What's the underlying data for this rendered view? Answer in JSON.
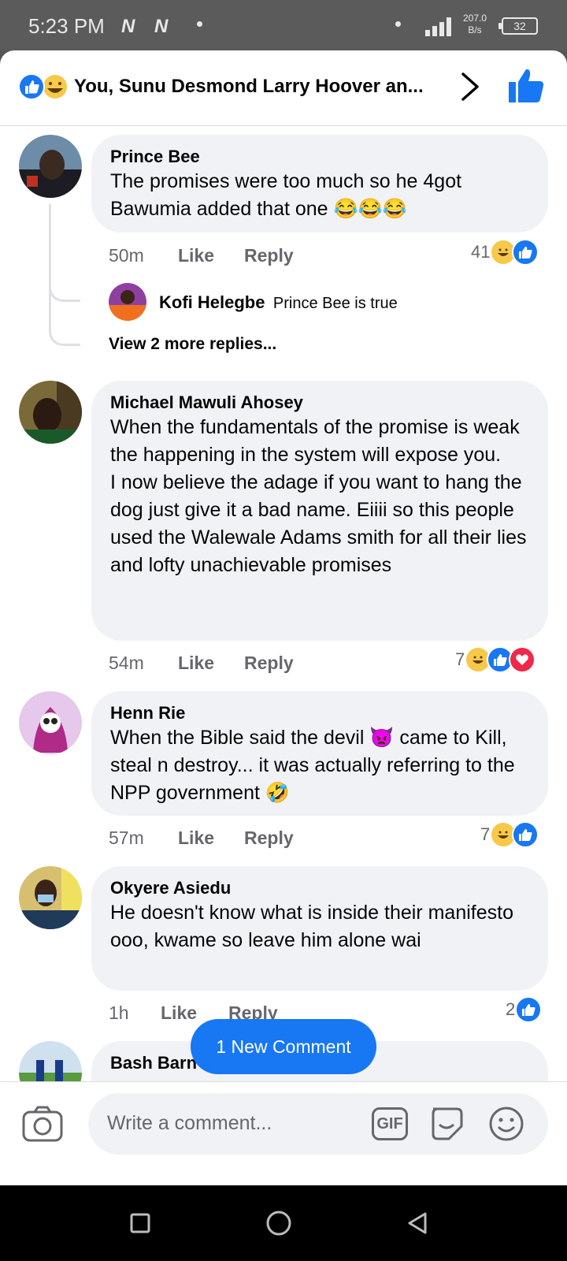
{
  "status_bar": {
    "time": "5:23 PM",
    "net_speed_value": "207.0",
    "net_speed_unit": "B/s",
    "battery": "32"
  },
  "header": {
    "title": "You, Sunu Desmond Larry Hoover an..."
  },
  "comments": [
    {
      "name": "Prince Bee",
      "text": "The promises were too much so he 4got Bawumia added that one 😂😂😂",
      "time": "50m",
      "like_label": "Like",
      "reply_label": "Reply",
      "reaction_count": "41",
      "reactions": [
        "haha",
        "like"
      ],
      "reply": {
        "name": "Kofi Helegbe",
        "text": "Prince Bee is true"
      },
      "more_replies": "View 2 more replies..."
    },
    {
      "name": "Michael Mawuli Ahosey",
      "text": "When the fundamentals of the promise is weak the happening in the system will expose you.\nI now believe the adage if you want to hang the dog just give it a bad name. Eiiii so this people used the Walewale Adams smith for all their lies and lofty unachievable promises",
      "time": "54m",
      "like_label": "Like",
      "reply_label": "Reply",
      "reaction_count": "7",
      "reactions": [
        "haha",
        "like",
        "love"
      ]
    },
    {
      "name": "Henn Rie",
      "text": "When the Bible said the devil 👿 came to Kill, steal n destroy... it was actually referring to the NPP government 🤣",
      "time": "57m",
      "like_label": "Like",
      "reply_label": "Reply",
      "reaction_count": "7",
      "reactions": [
        "haha",
        "like"
      ]
    },
    {
      "name": "Okyere Asiedu",
      "text": "He doesn't know what is inside their manifesto ooo, kwame so leave him alone wai",
      "time": "1h",
      "like_label": "Like",
      "reply_label": "Reply",
      "reaction_count": "2",
      "reactions": [
        "like"
      ]
    },
    {
      "name": "Bash Barn"
    }
  ],
  "new_comment_pill": "1 New Comment",
  "composer": {
    "placeholder": "Write a comment...",
    "gif_label": "GIF"
  },
  "icons": {
    "accent": "#1877f2",
    "haha": "#f7c94a",
    "love": "#f0284a"
  }
}
